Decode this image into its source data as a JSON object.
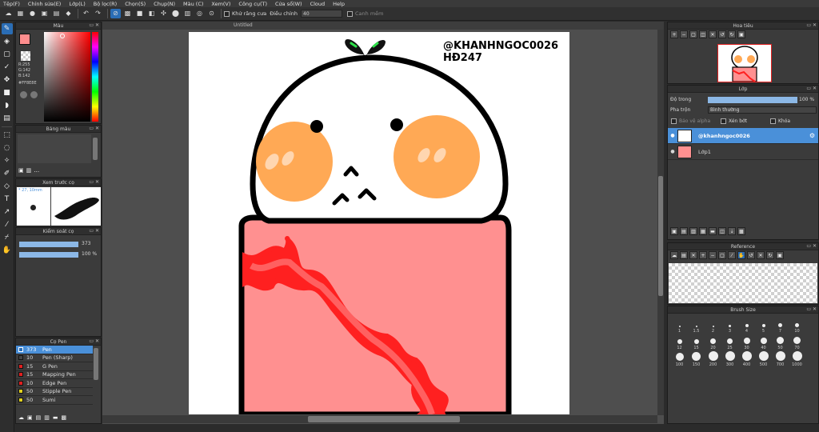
{
  "menu": [
    "Tệp(F)",
    "Chỉnh sửa(E)",
    "Lớp(L)",
    "Bộ lọc(R)",
    "Chọn(S)",
    "Chụp(N)",
    "Màu (C)",
    "Xem(V)",
    "Công cụ(T)",
    "Cửa sổ(W)",
    "Cloud",
    "Help"
  ],
  "toolbar": {
    "antialias_label": "Khử răng cưa",
    "adjust_label": "Điều chỉnh",
    "adjust_value": "40",
    "snap_label": "Canh mềm"
  },
  "color_panel": {
    "title": "Màu",
    "r": "R:255",
    "g": "G:142",
    "b": "B:142",
    "hex": "#FF8E8E",
    "fg_color": "#ff8e8e"
  },
  "palette_panel": {
    "title": "Bảng màu"
  },
  "brush_preview": {
    "title": "Xem trước cọ",
    "size_label": "* 27, 10mm"
  },
  "brush_control": {
    "title": "Kiểm soát cọ",
    "size_value": "373",
    "opacity_value": "100 %"
  },
  "pen_panel": {
    "title": "Cọ Pen",
    "items": [
      {
        "size": "373",
        "name": "Pen",
        "color": "#2a6db5"
      },
      {
        "size": "10",
        "name": "Pen (Sharp)",
        "color": "#444444"
      },
      {
        "size": "15",
        "name": "G Pen",
        "color": "#e02020"
      },
      {
        "size": "15",
        "name": "Mapping Pen",
        "color": "#e02020"
      },
      {
        "size": "10",
        "name": "Edge Pen",
        "color": "#e02020"
      },
      {
        "size": "50",
        "name": "Stipple Pen",
        "color": "#e0d020"
      },
      {
        "size": "50",
        "name": "Sumi",
        "color": "#e0d020"
      }
    ]
  },
  "canvas": {
    "tab_title": "Untitled",
    "watermark_line1": "@KHANHNGOC0026",
    "watermark_line2": "HĐ247"
  },
  "navigator": {
    "title": "Hoa tiêu"
  },
  "layers": {
    "title": "Lớp",
    "opacity_label": "Độ trong",
    "opacity_value": "100 %",
    "opacity_fraction": 1.0,
    "blend_label": "Pha trộn",
    "blend_value": "Bình thường",
    "protect_alpha_label": "Bảo vệ alpha",
    "clipping_label": "Xén bớt",
    "lock_label": "Khóa",
    "items": [
      {
        "name": "@khanhngoc0026",
        "selected": true
      },
      {
        "name": "Lớp1",
        "selected": false
      }
    ]
  },
  "reference": {
    "title": "Reference"
  },
  "brush_size": {
    "title": "Brush Size",
    "sizes": [
      "1",
      "1.5",
      "2",
      "3",
      "4",
      "5",
      "7",
      "10",
      "12",
      "15",
      "20",
      "25",
      "30",
      "40",
      "50",
      "70",
      "100",
      "150",
      "200",
      "300",
      "400",
      "500",
      "700",
      "1000"
    ]
  }
}
